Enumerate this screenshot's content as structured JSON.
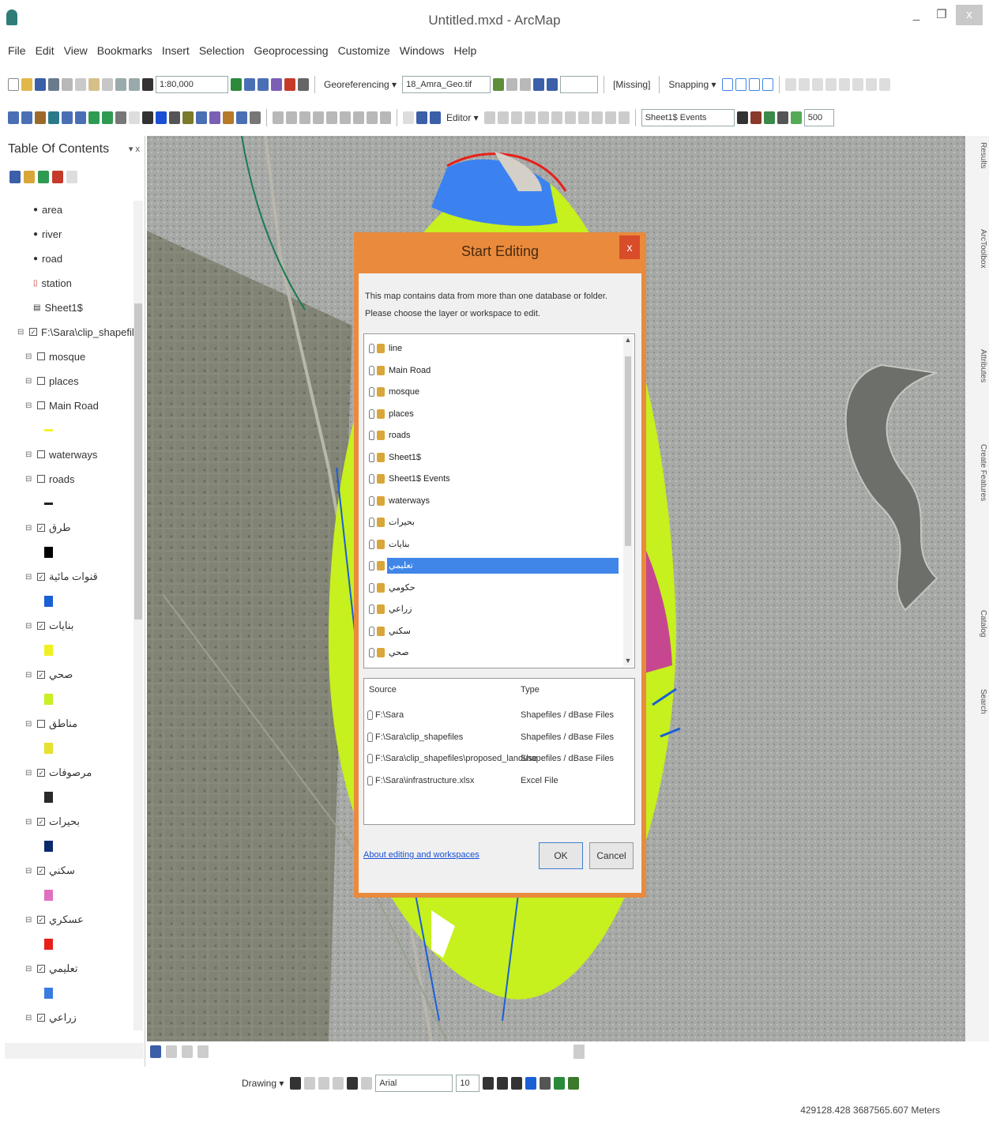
{
  "window": {
    "title": "Untitled.mxd - ArcMap",
    "minimize": "_",
    "maximize": "❐",
    "close": "x"
  },
  "menu": [
    "File",
    "Edit",
    "View",
    "Bookmarks",
    "Insert",
    "Selection",
    "Geoprocessing",
    "Customize",
    "Windows",
    "Help"
  ],
  "toolbar": {
    "scale": "1:80,000",
    "georeferencing_label": "Georeferencing ▾",
    "georef_layer": "18_Amra_Geo.tif",
    "missing_label": "[Missing]",
    "snapping_label": "Snapping ▾",
    "editor_label": "Editor ▾",
    "events_layer": "Sheet1$ Events",
    "zoom_value": "500"
  },
  "toc": {
    "title": "Table Of Contents",
    "pin": "▾ x",
    "items": [
      {
        "label": "area",
        "type": "point"
      },
      {
        "label": "river",
        "type": "point"
      },
      {
        "label": "road",
        "type": "point"
      },
      {
        "label": "station",
        "type": "station"
      },
      {
        "label": "Sheet1$",
        "type": "table"
      },
      {
        "label": "F:\\Sara\\clip_shapefiles",
        "type": "folder"
      },
      {
        "label": "mosque",
        "type": "layer-off"
      },
      {
        "label": "places",
        "type": "layer-off"
      },
      {
        "label": "Main Road",
        "type": "layer-off"
      },
      {
        "label": "waterways",
        "type": "layer-off"
      },
      {
        "label": "roads",
        "type": "layer-off"
      },
      {
        "label": "طرق",
        "type": "layer-on"
      },
      {
        "label": "قنوات مائية",
        "type": "layer-on"
      },
      {
        "label": "بنايات",
        "type": "layer-on"
      },
      {
        "label": "صحي",
        "type": "layer-on"
      },
      {
        "label": "مناطق",
        "type": "layer-off"
      },
      {
        "label": "مرصوفات",
        "type": "layer-on"
      },
      {
        "label": "بحيرات",
        "type": "layer-on"
      },
      {
        "label": "سكني",
        "type": "layer-on"
      },
      {
        "label": "عسكري",
        "type": "layer-on"
      },
      {
        "label": "تعليمي",
        "type": "layer-on"
      },
      {
        "label": "زراعي",
        "type": "layer-on"
      }
    ],
    "swatch_colors": [
      "#f5f22a",
      "#222222",
      "#000000",
      "#1a5fd6",
      "#f0f020",
      "#c8f023",
      "#e6e030",
      "#2a2a2a",
      "#0b2a6b",
      "#e06fc0",
      "#e8201a",
      "#3a7be0"
    ]
  },
  "dialog": {
    "title": "Start Editing",
    "close": "x",
    "message_line1": "This map contains data from more than one database or folder.",
    "message_line2": "Please choose the layer or workspace to edit.",
    "layers": [
      "line",
      "Main Road",
      "mosque",
      "places",
      "roads",
      "Sheet1$",
      "Sheet1$ Events",
      "waterways",
      "بحيرات",
      "بنايات",
      "تعليمي",
      "حكومي",
      "زراعي",
      "سكني",
      "صحي"
    ],
    "selected_layer": "تعليمي",
    "source_header": "Source",
    "type_header": "Type",
    "sources": [
      {
        "source": "F:\\Sara",
        "type": "Shapefiles / dBase Files"
      },
      {
        "source": "F:\\Sara\\clip_shapefiles",
        "type": "Shapefiles / dBase Files"
      },
      {
        "source": "F:\\Sara\\clip_shapefiles\\proposed_landuse",
        "type": "Shapefiles / dBase Files"
      },
      {
        "source": "F:\\Sara\\infrastructure.xlsx",
        "type": "Excel File"
      }
    ],
    "help_link": "About editing and workspaces",
    "ok": "OK",
    "cancel": "Cancel"
  },
  "side_tabs": [
    "Results",
    "ArcToolbox",
    "Attributes",
    "Create Features",
    "Catalog",
    "Search"
  ],
  "drawing": {
    "label": "Drawing ▾",
    "font": "Arial",
    "size": "10"
  },
  "status": {
    "coordinates": "429128.428  3687565.607 Meters"
  },
  "colors": {
    "dialog_frame": "#e98a3c",
    "dialog_close": "#d84c2a",
    "selection": "#3f86e8",
    "landuse_green": "#c6f01e",
    "river_blue": "#3b82f0"
  }
}
